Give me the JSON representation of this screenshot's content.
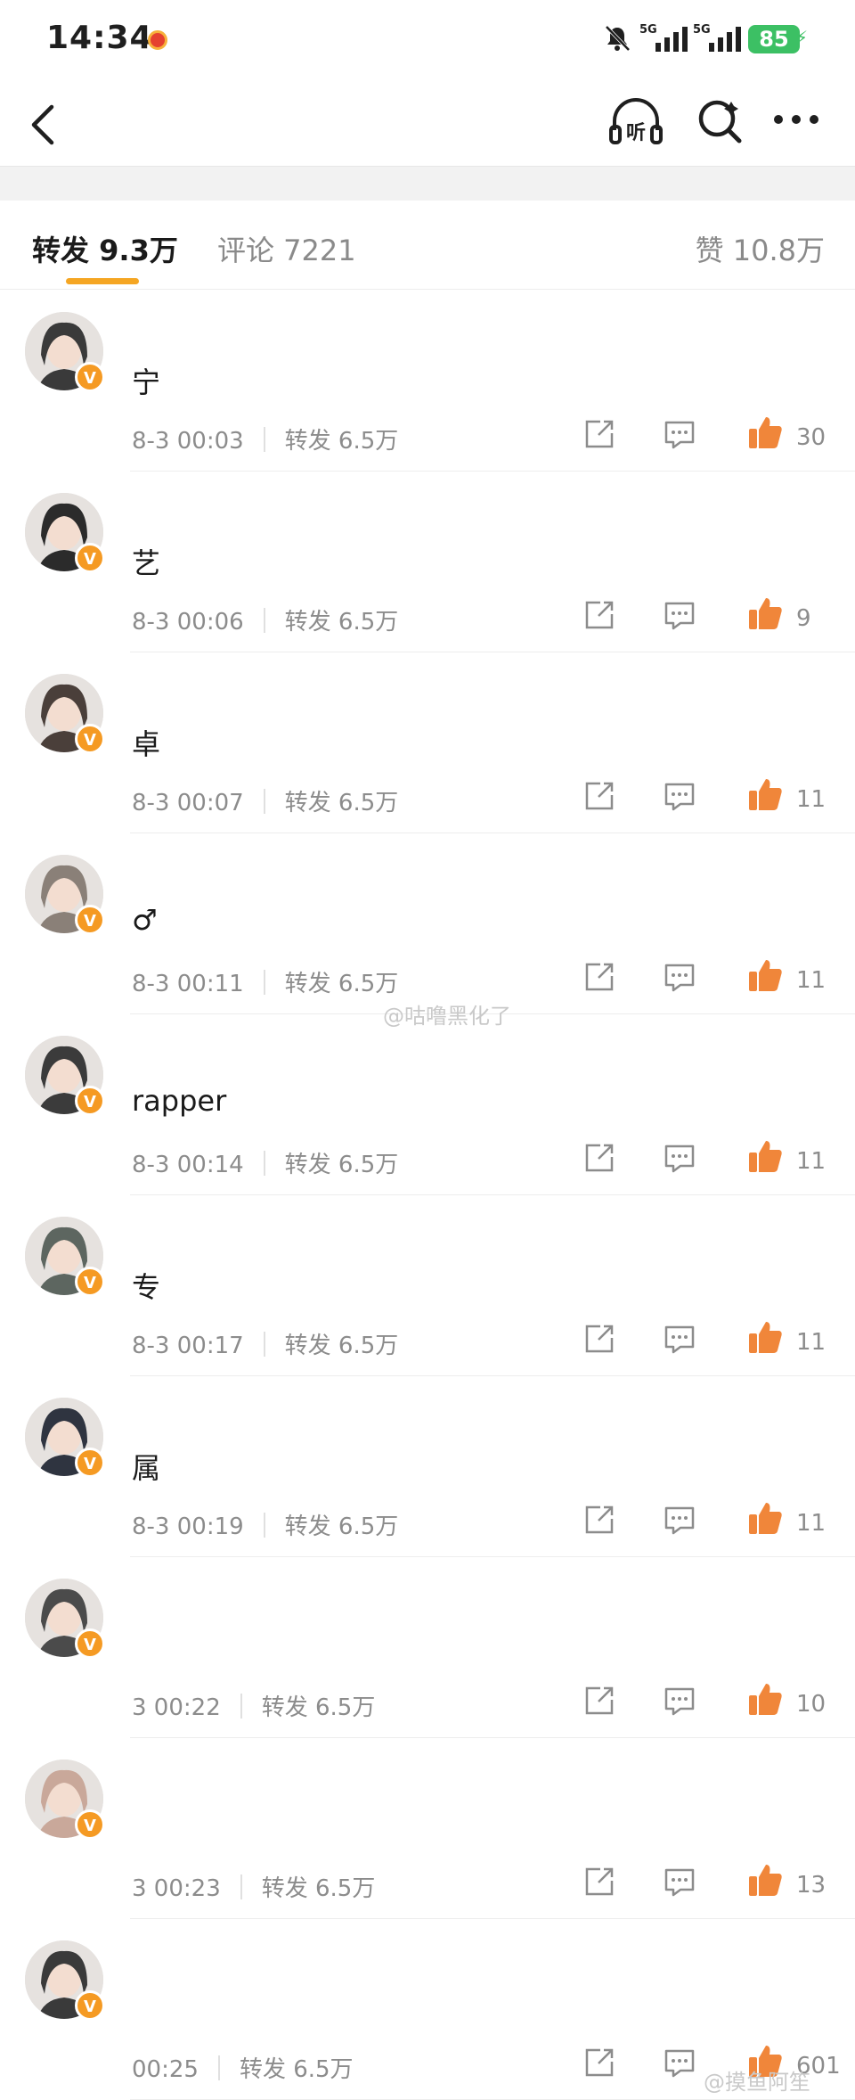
{
  "status_bar": {
    "time": "14:34",
    "net1": "5G",
    "net2": "5G",
    "battery": "85"
  },
  "nav": {
    "listen_label": "听"
  },
  "tabs": {
    "repost": "转发 9.3万",
    "comment": "评论 7221",
    "like": "赞 10.8万"
  },
  "reposts": [
    {
      "name": "宁",
      "time": "8-3 00:03",
      "repost": "转发 6.5万",
      "likes": "30"
    },
    {
      "name": "艺",
      "time": "8-3 00:06",
      "repost": "转发 6.5万",
      "likes": "9"
    },
    {
      "name": "卓",
      "time": "8-3 00:07",
      "repost": "转发 6.5万",
      "likes": "11"
    },
    {
      "name": "♂",
      "time": "8-3 00:11",
      "repost": "转发 6.5万",
      "likes": "11"
    },
    {
      "name": "rapper",
      "time": "8-3 00:14",
      "repost": "转发 6.5万",
      "likes": "11"
    },
    {
      "name": "专",
      "time": "8-3 00:17",
      "repost": "转发 6.5万",
      "likes": "11"
    },
    {
      "name": "属",
      "time": "8-3 00:19",
      "repost": "转发 6.5万",
      "likes": "11"
    },
    {
      "name": "",
      "time": "3 00:22",
      "repost": "转发 6.5万",
      "likes": "10"
    },
    {
      "name": "",
      "time": "3 00:23",
      "repost": "转发 6.5万",
      "likes": "13"
    },
    {
      "name": "",
      "time": "00:25",
      "repost": "转发 6.5万",
      "likes": "601"
    }
  ],
  "watermarks": {
    "middle": "@咕噜黑化了",
    "bottom": "@摸鱼阿笙"
  },
  "colors": {
    "accent": "#f5a623",
    "like": "#f0863a",
    "badge": "#f59a23"
  }
}
